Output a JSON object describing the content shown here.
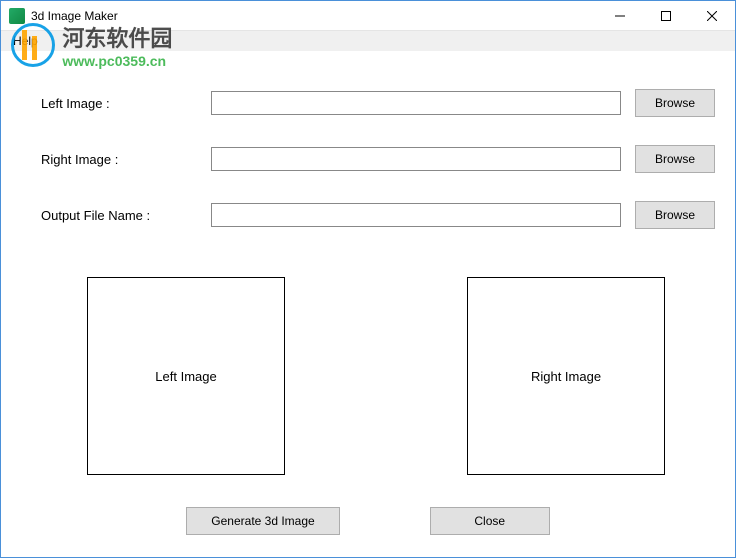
{
  "window": {
    "title": "3d Image Maker"
  },
  "menubar": {
    "help": "Help"
  },
  "form": {
    "left_image_label": "Left Image :",
    "right_image_label": "Right Image :",
    "output_label": "Output File Name :",
    "left_image_value": "",
    "right_image_value": "",
    "output_value": "",
    "browse_label": "Browse"
  },
  "previews": {
    "left_placeholder": "Left Image",
    "right_placeholder": "Right Image"
  },
  "buttons": {
    "generate": "Generate 3d Image",
    "close": "Close"
  },
  "watermark": {
    "text_cn": "河东软件园",
    "url": "www.pc0359.cn"
  }
}
